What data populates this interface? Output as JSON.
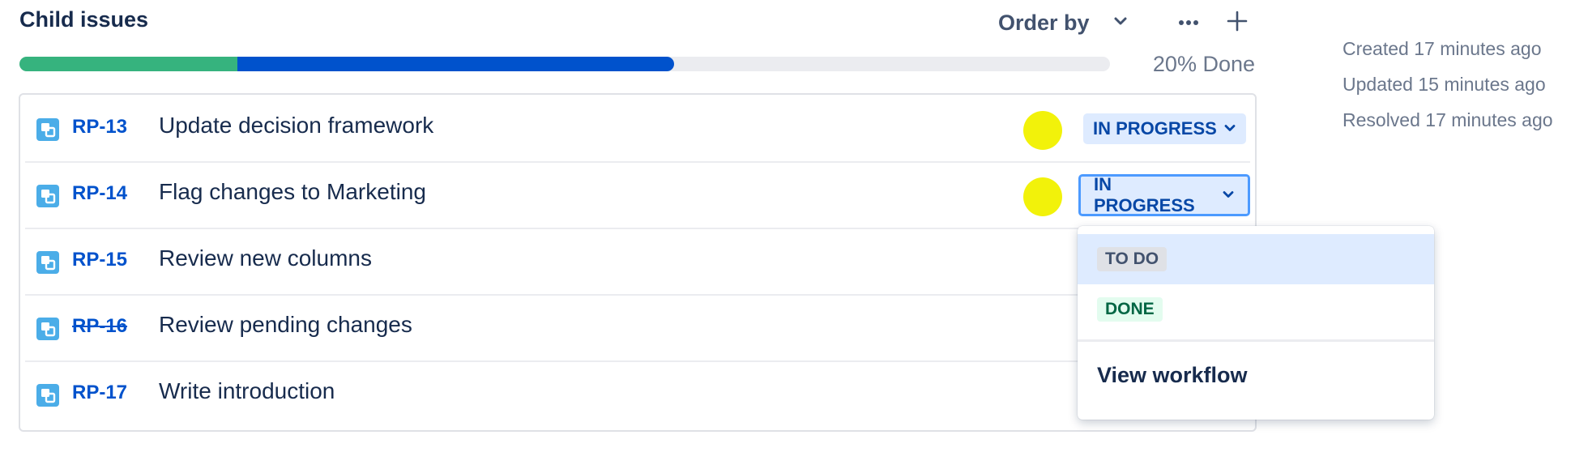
{
  "header": {
    "title": "Child issues",
    "order_by_label": "Order by",
    "icons": [
      "chevron-down-icon",
      "more-icon",
      "plus-icon"
    ]
  },
  "progress": {
    "done_fraction": 0.2,
    "in_progress_fraction": 0.4,
    "done_label": "20% Done",
    "colors": {
      "done": "#36B37E",
      "in_progress": "#0052CC",
      "todo": "#EBECF0"
    }
  },
  "meta": {
    "created": "Created 17 minutes ago",
    "updated": "Updated 15 minutes ago",
    "resolved": "Resolved 17 minutes ago"
  },
  "issues": [
    {
      "key": "RP-13",
      "summary": "Update decision framework",
      "status": "IN PROGRESS",
      "has_avatar": true,
      "resolved": false
    },
    {
      "key": "RP-14",
      "summary": "Flag changes to Marketing",
      "status": "IN PROGRESS",
      "has_avatar": true,
      "resolved": false
    },
    {
      "key": "RP-15",
      "summary": "Review new columns",
      "status": "",
      "has_avatar": false,
      "resolved": false
    },
    {
      "key": "RP-16",
      "summary": "Review pending changes",
      "status": "",
      "has_avatar": false,
      "resolved": true
    },
    {
      "key": "RP-17",
      "summary": "Write introduction",
      "status": "",
      "has_avatar": false,
      "resolved": false
    }
  ],
  "status_dropdown": {
    "options": [
      {
        "label": "TO DO",
        "bg": "#DFE1E6",
        "fg": "#42526E",
        "highlighted": true
      },
      {
        "label": "DONE",
        "bg": "#E3FCEF",
        "fg": "#006644",
        "highlighted": false
      }
    ],
    "view_workflow_label": "View workflow"
  },
  "colors": {
    "avatar": "#F2F20A",
    "link": "#0052CC",
    "subtask_icon": "#4BADE8"
  }
}
